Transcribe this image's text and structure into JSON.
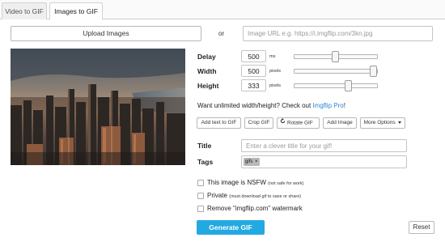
{
  "tabs": [
    {
      "label": "Video to GIF",
      "active": false
    },
    {
      "label": "Images to GIF",
      "active": true
    }
  ],
  "upload": {
    "button_label": "Upload Images",
    "or_label": "or",
    "url_placeholder": "Image URL e.g. https://i.imgflip.com/3kn.jpg"
  },
  "settings": {
    "delay": {
      "label": "Delay",
      "value": "500",
      "unit": "ms",
      "slider_fraction": 0.5
    },
    "width": {
      "label": "Width",
      "value": "500",
      "unit": "pixels",
      "slider_fraction": 0.98
    },
    "height": {
      "label": "Height",
      "value": "333",
      "unit": "pixels",
      "slider_fraction": 0.64
    }
  },
  "promo": {
    "text": "Want unlimited width/height? Check out ",
    "link": "Imgflip Pro",
    "suffix": "!"
  },
  "tools": {
    "add_text": "Add text to GIF",
    "crop": "Crop GIF",
    "rotate": "Rotate GIF",
    "add_image": "Add Image",
    "more_options": "More Options"
  },
  "form": {
    "title_label": "Title",
    "title_placeholder": "Enter a clever title for your gif!",
    "tags_label": "Tags",
    "tag": "gifs",
    "tag_remove": "×"
  },
  "options": {
    "nsfw": {
      "label": "This image is NSFW",
      "note": "(not safe for work)",
      "checked": false
    },
    "private": {
      "label": "Private",
      "note": "(must download gif to save or share)",
      "checked": false
    },
    "watermark": {
      "label": "Remove \"imgflip.com\" watermark",
      "checked": false
    }
  },
  "actions": {
    "generate": "Generate GIF",
    "reset": "Reset"
  },
  "colors": {
    "accent": "#23a9e2",
    "link": "#2a86d6",
    "tag_bg": "#b9b9b9"
  },
  "icons": {
    "rotate": "rotate-icon",
    "more": "caret-down-icon"
  }
}
